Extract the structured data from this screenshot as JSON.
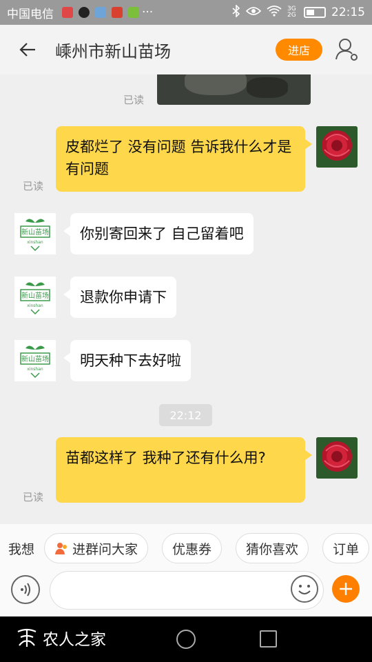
{
  "status_bar": {
    "carrier": "中国电信",
    "time": "22:15",
    "network": "3G 2G",
    "more": "···"
  },
  "header": {
    "title": "嵊州市新山苗场",
    "shop_button": "进店",
    "accent_color": "#ff8a00"
  },
  "chat": {
    "read_label": "已读",
    "timestamp": "22:12",
    "messages": [
      {
        "from": "me",
        "text": "皮都烂了  没有问题  告诉我什么才是有问题",
        "read": "已读"
      },
      {
        "from": "shop",
        "text": "你别寄回来了  自己留着吧"
      },
      {
        "from": "shop",
        "text": "退款你申请下"
      },
      {
        "from": "shop",
        "text": "明天种下去好啦"
      },
      {
        "from": "me",
        "text": "苗都这样了  我种了还有什么用?",
        "read": "已读"
      }
    ],
    "shop_logo": {
      "name": "新山苗场",
      "sub": "xinshan"
    }
  },
  "quick_bar": {
    "label": "我想",
    "chips": [
      "进群问大家",
      "优惠券",
      "猜你喜欢",
      "订单"
    ]
  },
  "input": {
    "placeholder": ""
  },
  "nav": {
    "watermark": "农人之家"
  }
}
